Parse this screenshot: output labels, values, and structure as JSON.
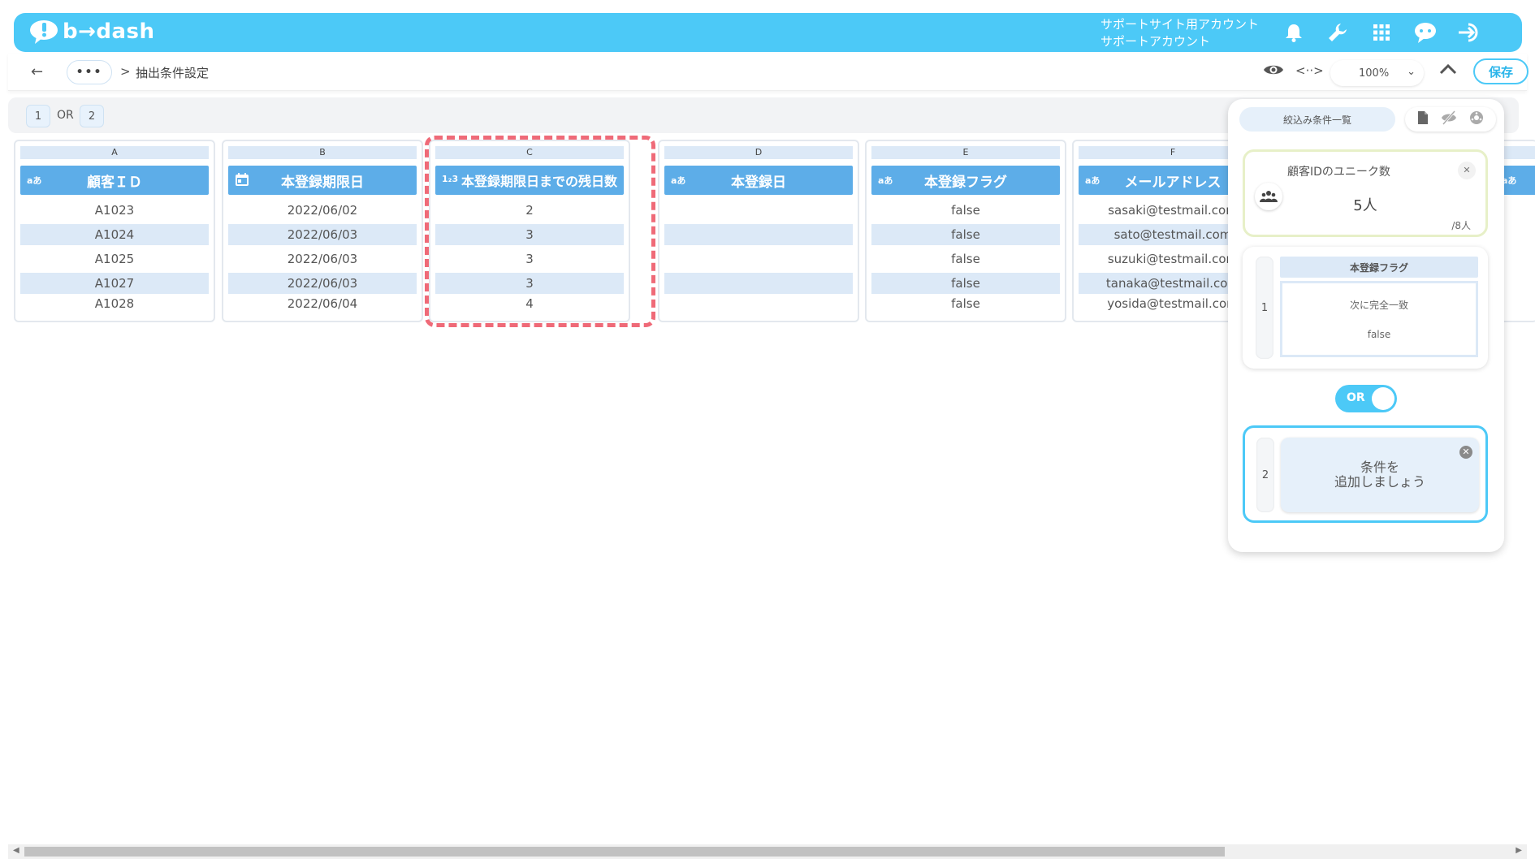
{
  "app": {
    "logo_text": "b→dash"
  },
  "account": {
    "line1": "サポートサイト用アカウント",
    "line2": "サポートアカウント"
  },
  "breadcrumb": {
    "more": "•••",
    "separator": ">",
    "current": "抽出条件設定"
  },
  "toolbar": {
    "zoom": "100%",
    "save_label": "保存"
  },
  "condition_strip": {
    "chip1": "1",
    "operator": "OR",
    "chip2": "2"
  },
  "table": {
    "columns": [
      {
        "letter": "A",
        "type_icon": "aあ",
        "header": "顧客ＩＤ",
        "cells": [
          "A1023",
          "A1024",
          "A1025",
          "A1027",
          "A1028"
        ]
      },
      {
        "letter": "B",
        "type_icon": "calendar",
        "header": "本登録期限日",
        "cells": [
          "2022/06/02",
          "2022/06/03",
          "2022/06/03",
          "2022/06/03",
          "2022/06/04"
        ]
      },
      {
        "letter": "C",
        "type_icon": "1₂3",
        "header": "本登録期限日までの残日数",
        "cells": [
          "2",
          "3",
          "3",
          "3",
          "4"
        ]
      },
      {
        "letter": "D",
        "type_icon": "aあ",
        "header": "本登録日",
        "cells": [
          "",
          "",
          "",
          "",
          ""
        ]
      },
      {
        "letter": "E",
        "type_icon": "aあ",
        "header": "本登録フラグ",
        "cells": [
          "false",
          "false",
          "false",
          "false",
          "false"
        ]
      },
      {
        "letter": "F",
        "type_icon": "aあ",
        "header": "メールアドレス",
        "cells": [
          "sasaki@testmail.com",
          "sato@testmail.com",
          "suzuki@testmail.com",
          "tanaka@testmail.com",
          "yosida@testmail.com"
        ]
      }
    ],
    "partial_type_icon": "aあ"
  },
  "panel": {
    "title": "絞込み条件一覧",
    "unique": {
      "title": "顧客IDのユニーク数",
      "value": "5人",
      "total": "/8人"
    },
    "condition1": {
      "number": "1",
      "column": "本登録フラグ",
      "operator": "次に完全一致",
      "value": "false"
    },
    "toggle": {
      "label": "OR"
    },
    "condition2": {
      "number": "2",
      "placeholder_line1": "条件を",
      "placeholder_line2": "追加しましょう"
    }
  },
  "colors": {
    "brand": "#4cc9f7",
    "header_blue": "#5dade8",
    "highlight": "#ef6a78"
  }
}
